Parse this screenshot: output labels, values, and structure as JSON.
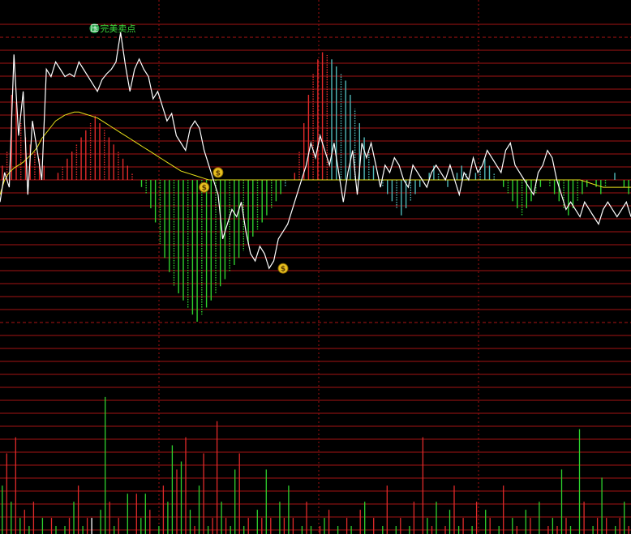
{
  "chart_data": {
    "type": "line",
    "annotation": {
      "label": "完美卖点",
      "badge": "压"
    },
    "colors": {
      "background": "#000000",
      "grid_line": "#c01818",
      "grid_dashed": "#c01818",
      "vertical_dotted": "#a01010",
      "white_line": "#ffffff",
      "yellow_line": "#e8e01a",
      "up_bar": "#e02a2a",
      "down_bar": "#2ed12e",
      "neutral_bar": "#4fb8b8",
      "badge_fill": "#2fa84f",
      "label_text": "#3ddc3d",
      "money_icon": "#e8c020"
    },
    "upper_panel": {
      "ylim": [
        -100,
        100
      ],
      "white_series": [
        -15,
        5,
        -5,
        85,
        30,
        60,
        -10,
        40,
        20,
        0,
        75,
        70,
        80,
        75,
        70,
        72,
        70,
        80,
        75,
        70,
        65,
        60,
        68,
        72,
        75,
        80,
        100,
        78,
        60,
        75,
        82,
        75,
        70,
        55,
        60,
        50,
        40,
        45,
        30,
        25,
        20,
        35,
        40,
        35,
        20,
        10,
        0,
        -10,
        -40,
        -30,
        -20,
        -25,
        -15,
        -35,
        -50,
        -55,
        -45,
        -50,
        -60,
        -55,
        -40,
        -35,
        -30,
        -20,
        -10,
        0,
        10,
        25,
        15,
        30,
        20,
        10,
        25,
        5,
        -15,
        5,
        20,
        -10,
        25,
        15,
        25,
        10,
        -5,
        10,
        5,
        15,
        10,
        0,
        -5,
        10,
        5,
        0,
        -5,
        5,
        10,
        5,
        0,
        10,
        0,
        -10,
        5,
        0,
        15,
        5,
        10,
        20,
        15,
        10,
        5,
        20,
        25,
        10,
        5,
        0,
        -5,
        -10,
        5,
        10,
        20,
        15,
        0,
        -10,
        -20,
        -15,
        -20,
        -25,
        -15,
        -20,
        -25,
        -30,
        -20,
        -15,
        -20,
        -25,
        -20,
        -15,
        -25
      ],
      "yellow_series": [
        -10,
        0,
        5,
        8,
        10,
        12,
        15,
        18,
        22,
        28,
        32,
        36,
        40,
        42,
        44,
        45,
        46,
        46,
        45,
        44,
        43,
        42,
        40,
        38,
        36,
        34,
        32,
        30,
        28,
        26,
        24,
        22,
        20,
        18,
        16,
        14,
        12,
        10,
        8,
        6,
        5,
        4,
        3,
        2,
        1,
        0,
        0,
        0,
        0,
        0,
        0,
        0,
        0,
        0,
        0,
        0,
        0,
        0,
        0,
        0,
        0,
        0,
        0,
        0,
        0,
        0,
        0,
        0,
        0,
        0,
        0,
        0,
        0,
        0,
        0,
        0,
        0,
        0,
        0,
        0,
        0,
        0,
        0,
        0,
        0,
        0,
        0,
        0,
        0,
        0,
        0,
        0,
        0,
        0,
        0,
        0,
        0,
        0,
        0,
        0,
        0,
        0,
        0,
        0,
        0,
        0,
        0,
        0,
        0,
        0,
        0,
        0,
        0,
        0,
        0,
        0,
        0,
        0,
        0,
        0,
        0,
        0,
        0,
        0,
        0,
        0,
        -1,
        -2,
        -3,
        -4,
        -5,
        -5,
        -5,
        -5,
        -5,
        -5,
        -5,
        -5
      ],
      "histogram": [
        10,
        20,
        60,
        55,
        40,
        30,
        25,
        20,
        15,
        10,
        0,
        0,
        5,
        10,
        15,
        20,
        25,
        30,
        35,
        40,
        45,
        40,
        35,
        30,
        25,
        20,
        15,
        10,
        5,
        0,
        -5,
        -10,
        -20,
        -30,
        -45,
        -55,
        -65,
        -75,
        -80,
        -85,
        -90,
        -95,
        -100,
        -95,
        -90,
        -85,
        -80,
        -75,
        -70,
        -65,
        -60,
        -55,
        -50,
        -45,
        -40,
        -35,
        -30,
        -25,
        -20,
        -15,
        -10,
        -5,
        0,
        5,
        20,
        40,
        60,
        75,
        85,
        90,
        88,
        85,
        80,
        75,
        70,
        60,
        50,
        40,
        30,
        20,
        10,
        0,
        -5,
        -10,
        -15,
        -20,
        -25,
        -20,
        -15,
        -10,
        -5,
        0,
        5,
        10,
        5,
        0,
        -5,
        0,
        5,
        10,
        5,
        0,
        5,
        10,
        15,
        10,
        5,
        0,
        -5,
        -10,
        -15,
        -20,
        -25,
        -20,
        -15,
        -10,
        -5,
        0,
        -5,
        -10,
        -15,
        -20,
        -25,
        -20,
        -15,
        -10,
        -5,
        0,
        -5,
        -10,
        -5,
        0,
        5,
        0,
        -5,
        -10,
        -15,
        -20,
        -25,
        -20,
        -15,
        -20,
        -25,
        -30,
        -25
      ],
      "money_markers": [
        {
          "x": 44,
          "y": -5
        },
        {
          "x": 47,
          "y": 5
        },
        {
          "x": 61,
          "y": -60
        }
      ],
      "annotation_x": 20
    },
    "lower_panel": {
      "ylim": [
        0,
        100
      ],
      "volume": [
        30,
        50,
        20,
        60,
        10,
        15,
        5,
        20,
        0,
        10,
        0,
        10,
        5,
        0,
        5,
        10,
        20,
        30,
        5,
        10,
        10,
        0,
        15,
        85,
        20,
        5,
        10,
        0,
        25,
        0,
        25,
        10,
        25,
        15,
        0,
        5,
        30,
        20,
        55,
        40,
        45,
        60,
        15,
        5,
        30,
        50,
        5,
        10,
        70,
        20,
        10,
        5,
        40,
        50,
        5,
        10,
        0,
        15,
        10,
        40,
        10,
        0,
        20,
        10,
        30,
        10,
        0,
        5,
        20,
        5,
        0,
        5,
        10,
        15,
        0,
        5,
        0,
        10,
        5,
        0,
        15,
        20,
        0,
        10,
        0,
        5,
        30,
        0,
        5,
        10,
        0,
        5,
        20,
        0,
        60,
        10,
        5,
        20,
        0,
        5,
        15,
        30,
        5,
        10,
        0,
        5,
        20,
        0,
        15,
        10,
        0,
        5,
        30,
        0,
        10,
        5,
        0,
        15,
        10,
        0,
        20,
        0,
        5,
        10,
        5,
        40,
        10,
        5,
        0,
        65,
        20,
        0,
        5,
        10,
        35,
        10,
        0,
        5,
        10,
        20,
        5
      ],
      "volume_color": [
        "g",
        "r",
        "g",
        "r",
        "g",
        "r",
        "g",
        "r",
        "w",
        "g",
        "w",
        "r",
        "g",
        "w",
        "g",
        "r",
        "g",
        "r",
        "g",
        "r",
        "w",
        "w",
        "g",
        "g",
        "r",
        "g",
        "r",
        "w",
        "g",
        "w",
        "r",
        "g",
        "g",
        "r",
        "w",
        "g",
        "r",
        "g",
        "g",
        "r",
        "g",
        "r",
        "g",
        "r",
        "g",
        "r",
        "g",
        "r",
        "r",
        "g",
        "r",
        "g",
        "g",
        "r",
        "g",
        "r",
        "w",
        "g",
        "r",
        "g",
        "r",
        "w",
        "g",
        "r",
        "g",
        "r",
        "w",
        "g",
        "r",
        "g",
        "w",
        "r",
        "g",
        "r",
        "w",
        "g",
        "w",
        "r",
        "g",
        "w",
        "r",
        "g",
        "w",
        "r",
        "w",
        "g",
        "r",
        "w",
        "g",
        "r",
        "w",
        "g",
        "r",
        "w",
        "r",
        "g",
        "r",
        "g",
        "w",
        "r",
        "g",
        "r",
        "g",
        "r",
        "w",
        "g",
        "r",
        "w",
        "g",
        "r",
        "w",
        "g",
        "r",
        "w",
        "g",
        "r",
        "w",
        "g",
        "r",
        "w",
        "g",
        "w",
        "r",
        "g",
        "r",
        "g",
        "r",
        "g",
        "w",
        "g",
        "r",
        "w",
        "g",
        "r",
        "g",
        "r",
        "w",
        "g",
        "r",
        "g",
        "r"
      ]
    }
  }
}
